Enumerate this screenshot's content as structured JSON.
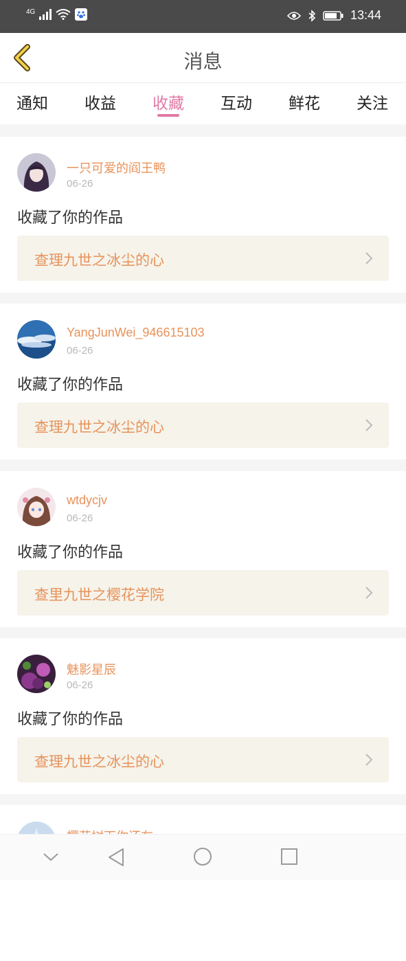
{
  "status_bar": {
    "network": "4G",
    "time": "13:44"
  },
  "header": {
    "title": "消息"
  },
  "tabs": [
    {
      "label": "通知"
    },
    {
      "label": "收益"
    },
    {
      "label": "收藏",
      "active": true
    },
    {
      "label": "互动"
    },
    {
      "label": "鲜花"
    },
    {
      "label": "关注"
    }
  ],
  "messages": [
    {
      "username": "一只可爱的阎王鸭",
      "date": "06-26",
      "action": "收藏了你的作品",
      "work": "查理九世之冰尘的心"
    },
    {
      "username": "YangJunWei_946615103",
      "date": "06-26",
      "action": "收藏了你的作品",
      "work": "查理九世之冰尘的心"
    },
    {
      "username": "wtdycjv",
      "date": "06-26",
      "action": "收藏了你的作品",
      "work": "查里九世之樱花学院"
    },
    {
      "username": "魅影星辰",
      "date": "06-26",
      "action": "收藏了你的作品",
      "work": "查理九世之冰尘的心"
    },
    {
      "username": "樱花树下你还在",
      "date": "",
      "action": "",
      "work": ""
    }
  ],
  "colors": {
    "accent_pink": "#e27aa6",
    "accent_orange": "#e8925a",
    "work_bg": "#f5f3ea"
  }
}
